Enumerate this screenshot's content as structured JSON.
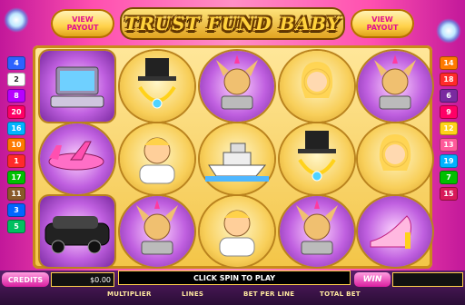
{
  "game": {
    "title": "TRUST FUND BABY",
    "payout_button": {
      "line1": "VIEW",
      "line2": "PAYOUT"
    },
    "left_lines": [
      {
        "label": "4",
        "color": "#2d62ff"
      },
      {
        "label": "2",
        "color": "#ffffff"
      },
      {
        "label": "8",
        "color": "#b700ff"
      },
      {
        "label": "20",
        "color": "#ff0066"
      },
      {
        "label": "16",
        "color": "#00b3ff"
      },
      {
        "label": "10",
        "color": "#ff7a00"
      },
      {
        "label": "1",
        "color": "#ff2a2a"
      },
      {
        "label": "17",
        "color": "#00c000"
      },
      {
        "label": "11",
        "color": "#8a5a2a"
      },
      {
        "label": "3",
        "color": "#0066ff"
      },
      {
        "label": "5",
        "color": "#00c060"
      }
    ],
    "right_lines": [
      {
        "label": "14",
        "color": "#ff7a00"
      },
      {
        "label": "18",
        "color": "#ff2a2a"
      },
      {
        "label": "6",
        "color": "#7a2aa0"
      },
      {
        "label": "9",
        "color": "#ff0066"
      },
      {
        "label": "12",
        "color": "#ffd21a"
      },
      {
        "label": "13",
        "color": "#ff5a9a"
      },
      {
        "label": "19",
        "color": "#00b3ff"
      },
      {
        "label": "7",
        "color": "#00c000"
      },
      {
        "label": "15",
        "color": "#d81a5a"
      }
    ],
    "reels": [
      [
        "laptop-symbol",
        "jet-symbol",
        "limo-symbol"
      ],
      [
        "necklace-symbol",
        "man-symbol",
        "dog-symbol"
      ],
      [
        "dog-symbol",
        "yacht-symbol",
        "man-symbol"
      ],
      [
        "woman-symbol",
        "necklace-symbol",
        "dog-symbol"
      ],
      [
        "dog-symbol",
        "woman-symbol",
        "shoe-symbol"
      ]
    ],
    "credits_label": "CREDITS",
    "credits_value": "$0.00",
    "message": "CLICK SPIN TO PLAY",
    "win_label": "WIN",
    "controls": [
      "MULTIPLIER",
      "LINES",
      "BET PER LINE",
      "TOTAL BET"
    ]
  }
}
